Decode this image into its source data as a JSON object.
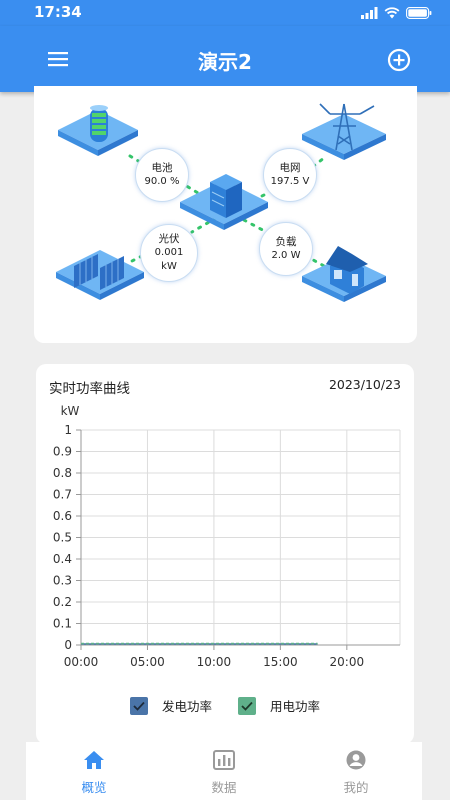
{
  "status_bar": {
    "time": "17:34"
  },
  "app_bar": {
    "title": "演示2",
    "menu_icon": "menu-icon",
    "add_icon": "add-circle-icon"
  },
  "energy_flow": {
    "battery": {
      "label": "电池",
      "value": "90.0 %"
    },
    "grid": {
      "label": "电网",
      "value": "197.5 V"
    },
    "pv": {
      "label": "光伏",
      "value": "0.001",
      "unit": "kW"
    },
    "load": {
      "label": "负载",
      "value": "2.0 W"
    },
    "flow_color": "#35c46a"
  },
  "chart": {
    "title": "实时功率曲线",
    "date": "2023/10/23",
    "legend": [
      {
        "label": "发电功率",
        "color": "#4a74a8"
      },
      {
        "label": "用电功率",
        "color": "#5fb08a"
      }
    ]
  },
  "chart_data": {
    "type": "line",
    "ylabel": "kW",
    "ylim": [
      0,
      1
    ],
    "yticks": [
      "0",
      "0.1",
      "0.2",
      "0.3",
      "0.4",
      "0.5",
      "0.6",
      "0.7",
      "0.8",
      "0.9",
      "1"
    ],
    "xlim": [
      0,
      24
    ],
    "xticks": [
      "00:00",
      "05:00",
      "10:00",
      "15:00",
      "20:00"
    ],
    "grid": true,
    "series": [
      {
        "name": "发电功率",
        "color": "#4a74a8",
        "x": [
          0,
          17.8
        ],
        "y": [
          0.0,
          0.0
        ]
      },
      {
        "name": "用电功率",
        "color": "#5fb08a",
        "x": [
          0,
          17.8
        ],
        "y": [
          0.002,
          0.002
        ]
      }
    ]
  },
  "bottom_nav": [
    {
      "label": "概览",
      "icon": "home-icon",
      "active": true
    },
    {
      "label": "数据",
      "icon": "chart-icon",
      "active": false
    },
    {
      "label": "我的",
      "icon": "user-icon",
      "active": false
    }
  ],
  "colors": {
    "primary": "#3a8ef0",
    "inactive": "#9a9a9a"
  }
}
